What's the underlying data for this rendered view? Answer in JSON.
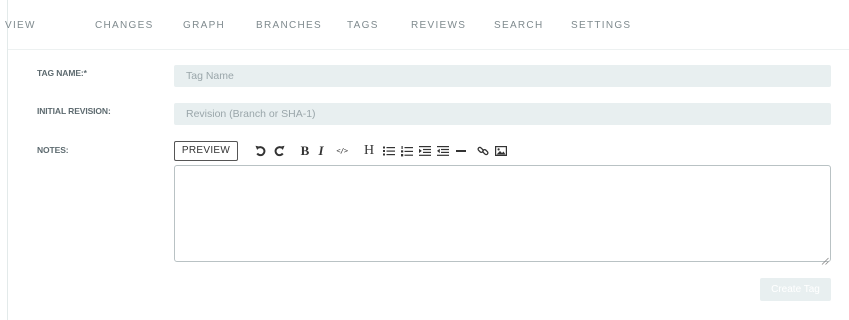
{
  "nav": {
    "items": [
      {
        "label": "View"
      },
      {
        "label": "Changes"
      },
      {
        "label": "Graph"
      },
      {
        "label": "Branches"
      },
      {
        "label": "Tags"
      },
      {
        "label": "Reviews"
      },
      {
        "label": "Search"
      },
      {
        "label": "Settings"
      }
    ]
  },
  "form": {
    "tag_name": {
      "label": "TAG NAME:*",
      "value": "",
      "placeholder": "Tag Name"
    },
    "initial_revision": {
      "label": "INITIAL REVISION:",
      "value": "",
      "placeholder": "Revision (Branch or SHA-1)"
    },
    "notes": {
      "label": "NOTES:",
      "value": ""
    }
  },
  "editor": {
    "preview_label": "Preview",
    "tools": [
      {
        "icon": "undo-icon"
      },
      {
        "icon": "redo-icon"
      },
      {
        "icon": "bold-icon",
        "glyph": "B"
      },
      {
        "icon": "italic-icon",
        "glyph": "I"
      },
      {
        "icon": "code-icon",
        "glyph": "</>"
      },
      {
        "icon": "heading-icon",
        "glyph": "H"
      },
      {
        "icon": "bulleted-list-icon"
      },
      {
        "icon": "numbered-list-icon"
      },
      {
        "icon": "indent-icon"
      },
      {
        "icon": "outdent-icon"
      },
      {
        "icon": "horizontal-rule-icon"
      },
      {
        "icon": "link-icon"
      },
      {
        "icon": "image-icon"
      }
    ]
  },
  "actions": {
    "create_label": "Create Tag"
  },
  "colors": {
    "input_bg": "#e8eff0",
    "nav_text": "#7f8a8e",
    "label_text": "#5d6a6f",
    "button_disabled_text": "#ffffff"
  }
}
